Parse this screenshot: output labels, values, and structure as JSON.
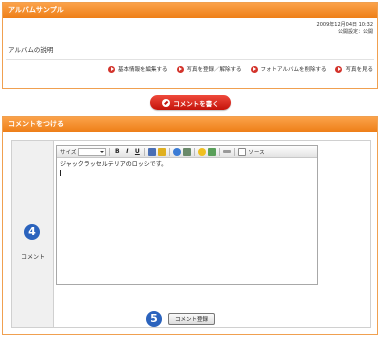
{
  "album": {
    "title": "アルバムサンプル",
    "date": "2009年12月04日 10:32",
    "visibility": "公開設定：公開",
    "description": "アルバムの説明",
    "links": [
      {
        "label": "基本情報を編集する"
      },
      {
        "label": "写真を登録／解除する"
      },
      {
        "label": "フォトアルバムを削除する"
      },
      {
        "label": "写真を見る"
      }
    ]
  },
  "write_button": {
    "label": "コメントを書く"
  },
  "comment": {
    "header": "コメントをつける",
    "label": "コメント",
    "step_badge_1": "4",
    "step_badge_2": "5",
    "toolbar": {
      "size_label": "サイズ",
      "bold": "B",
      "italic": "I",
      "underline": "U",
      "source_label": "ソース"
    },
    "text": "ジャックラッセルテリアのロッシです。",
    "submit_label": "コメント登録"
  },
  "colors": {
    "header_orange": "#ee7f18",
    "button_red": "#c4130a",
    "badge_blue": "#2b63bd"
  }
}
